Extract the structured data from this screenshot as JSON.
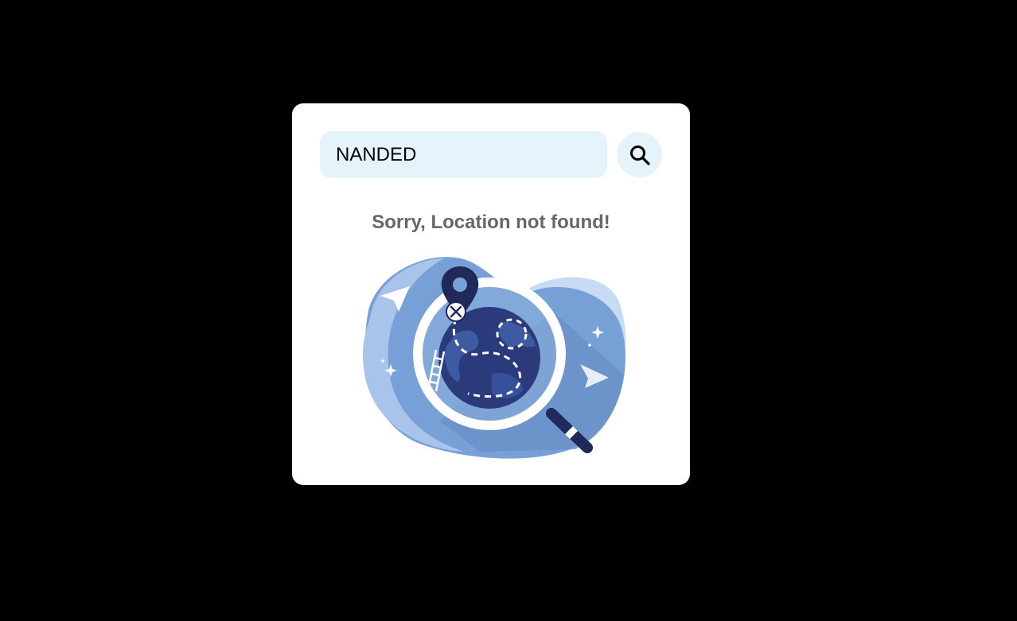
{
  "search": {
    "value": "NANDED",
    "icon": "search-icon"
  },
  "message": {
    "text": "Sorry, Location not found!"
  },
  "illustration": {
    "icon": "location-not-found-illustration"
  },
  "colors": {
    "background": "#000000",
    "card": "#ffffff",
    "input_bg": "#e5f4fb",
    "message_text": "#666666",
    "blob_blue": "#76a0d6",
    "light_blue": "#c7dcf4",
    "dark_navy": "#1f2a5a"
  }
}
